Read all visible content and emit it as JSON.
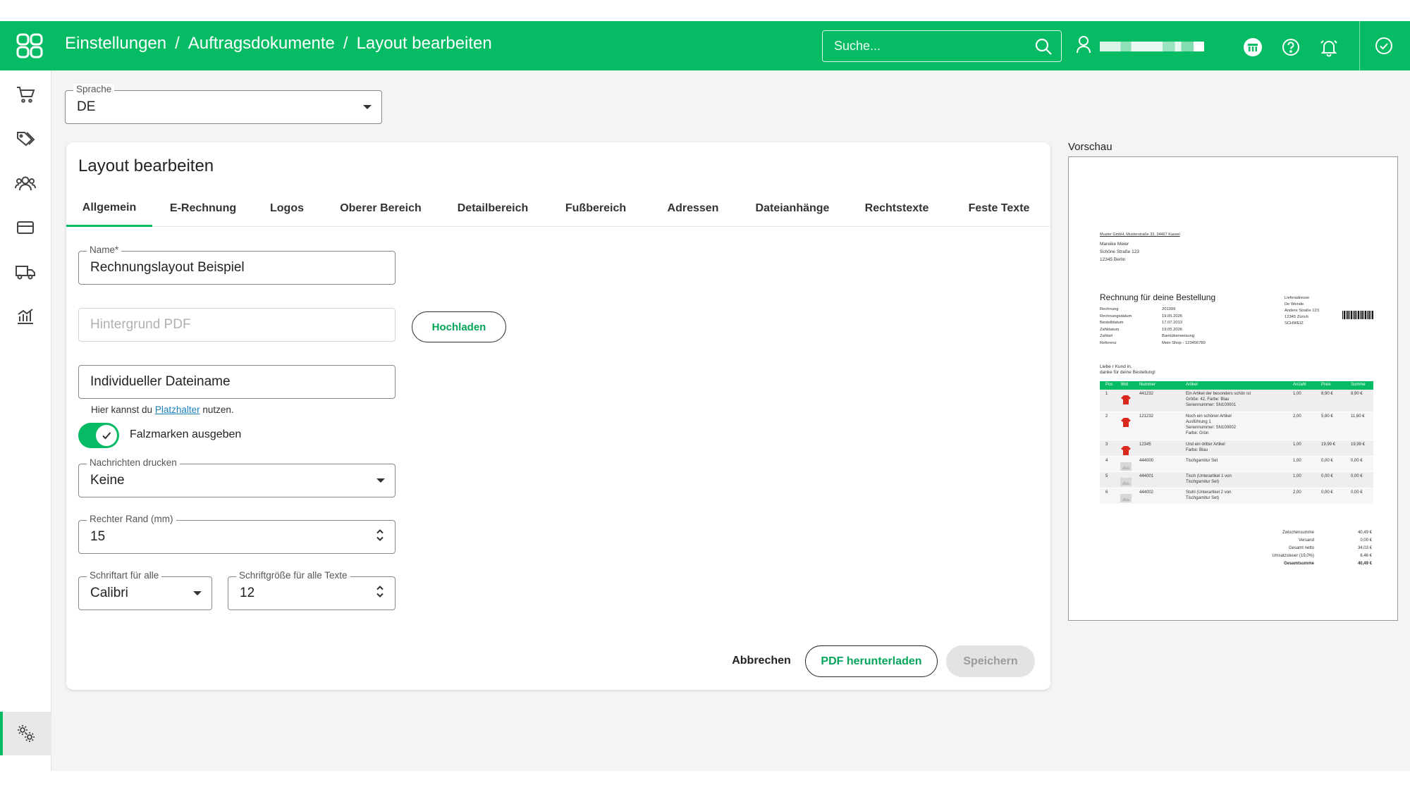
{
  "header": {
    "breadcrumb": [
      "Einstellungen",
      "Auftragsdokumente",
      "Layout bearbeiten"
    ],
    "breadcrumb_sep": "/",
    "search_placeholder": "Suche..."
  },
  "language": {
    "label": "Sprache",
    "value": "DE"
  },
  "card": {
    "title": "Layout bearbeiten",
    "tabs": [
      "Allgemein",
      "E-Rechnung",
      "Logos",
      "Oberer Bereich",
      "Detailbereich",
      "Fußbereich",
      "Adressen",
      "Dateianhänge",
      "Rechtstexte",
      "Feste Texte"
    ],
    "active_tab": "Allgemein"
  },
  "form": {
    "name_label": "Name*",
    "name_value": "Rechnungslayout Beispiel",
    "background_pdf_placeholder": "Hintergrund PDF",
    "upload_button": "Hochladen",
    "filename_placeholder": "Individueller Dateiname",
    "helper_prefix": "Hier kannst du",
    "helper_link": "Platzhalter",
    "helper_suffix": "nutzen.",
    "fold_marks_label": "Falzmarken ausgeben",
    "fold_marks_on": true,
    "messages_label": "Nachrichten drucken",
    "messages_value": "Keine",
    "right_margin_label": "Rechter Rand (mm)",
    "right_margin_value": "15",
    "font_label": "Schriftart für alle",
    "font_value": "Calibri",
    "font_size_label": "Schriftgröße für alle Texte",
    "font_size_value": "12"
  },
  "actions": {
    "cancel": "Abbrechen",
    "download_pdf": "PDF herunterladen",
    "save": "Speichern"
  },
  "preview": {
    "label": "Vorschau",
    "sender_line": "Muster GmbH, Musterstraße 33, 34467 Kassel",
    "recipient": [
      "Mareike Meier",
      "Schöne Straße 123",
      "12345 Berlin"
    ],
    "heading": "Rechnung für deine Bestellung",
    "meta_keys": [
      "Rechnung",
      "Rechnungsdatum",
      "Bestelldatum",
      "Zahldatum",
      "Zahlart",
      "Referenz"
    ],
    "meta_values": [
      "201399",
      "19.05.2026",
      "17.07.2013",
      "19.05.2026",
      "Banküberweisung",
      "Mein Shop - 123456789"
    ],
    "delivery": [
      "Lieferadresse",
      "De Wende",
      "Andere Straße 123",
      "12345 Zürich",
      "SCHWEIZ"
    ],
    "greeting": [
      "Liebe r Kund in,",
      "danke für deine Bestellung!"
    ],
    "table_headers": [
      "Pos",
      "Bild",
      "Nummer",
      "Artikel",
      "Anzahl",
      "Preis",
      "Summe"
    ],
    "rows": [
      {
        "pos": "1",
        "num": "441232",
        "text": [
          "Ein Artikel der besonders schön ist",
          "Größe: 42, Farbe: Blau",
          "Seriennummer: SN100001"
        ],
        "qty": "1,00",
        "price": "8,90 €",
        "sum": "8,90 €",
        "img": "red"
      },
      {
        "pos": "2",
        "num": "121232",
        "text": [
          "Noch ein schöner Artikel",
          "Ausführung 1",
          "Seriennummer: SN100002",
          "Farbe: Grün"
        ],
        "qty": "2,00",
        "price": "5,80 €",
        "sum": "11,60 €",
        "img": "red"
      },
      {
        "pos": "3",
        "num": "12345",
        "text": [
          "Und ein dritter Artikel",
          "Farbe: Blau"
        ],
        "qty": "1,00",
        "price": "19,99 €",
        "sum": "19,99 €",
        "img": "red"
      },
      {
        "pos": "4",
        "num": "444000",
        "text": [
          "Tischgarnitur Set"
        ],
        "qty": "1,00",
        "price": "0,00 €",
        "sum": "0,00 €",
        "img": "grey"
      },
      {
        "pos": "5",
        "num": "444001",
        "text": [
          "Tisch (Unterartikel 1 von",
          "Tischgarnitur Set)"
        ],
        "qty": "1,00",
        "price": "0,00 €",
        "sum": "0,00 €",
        "img": "grey"
      },
      {
        "pos": "6",
        "num": "444002",
        "text": [
          "Stuhl (Unterartikel 2 von",
          "Tischgarnitur Set)"
        ],
        "qty": "2,00",
        "price": "0,00 €",
        "sum": "0,00 €",
        "img": "grey"
      }
    ],
    "totals": [
      {
        "label": "Zwischensumme",
        "value": "40,49 €"
      },
      {
        "label": "Versand",
        "value": "0,00 €"
      },
      {
        "label": "Gesamt netto",
        "value": "34,03 €"
      },
      {
        "label": "Umsatzsteuer (19,0%)",
        "value": "6,46 €"
      },
      {
        "label": "Gesamtsumme",
        "value": "40,49 €"
      }
    ]
  },
  "colors": {
    "brand": "#05bb63",
    "link": "#1a7fb8"
  }
}
